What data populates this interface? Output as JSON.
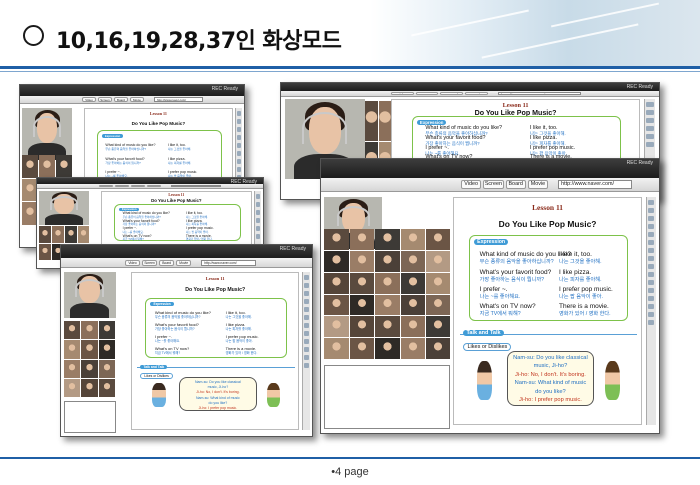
{
  "title": "10,16,19,28,37인 화상모드",
  "footer": "•4 page",
  "window": {
    "app_title": "REC Ready",
    "toolbar": [
      "Video",
      "Screen",
      "Board",
      "Movie"
    ],
    "url": "http://www.naver.com/"
  },
  "lesson": {
    "number": "Lesson 11",
    "question": "Do You Like Pop Music?",
    "expression_tag": "Expression",
    "lines": [
      {
        "en": "What kind of music do you like?",
        "ko": "무슨 종류의 음악을 좋아하십니까?"
      },
      {
        "en": "What's your favorit food?",
        "ko": "가장 좋아하는 음식이 뭡니까?"
      },
      {
        "en": "I prefer ~.",
        "ko": "나는 ~를 좋아해요."
      },
      {
        "en": "What's on TV now?",
        "ko": "지금 TV에서 뭐해?"
      }
    ],
    "answers": [
      {
        "en": "I like it, too.",
        "ko": "나는 그것을 좋아해."
      },
      {
        "en": "I like pizza.",
        "ko": "나는 피자를 좋아해."
      },
      {
        "en": "I prefer pop music.",
        "ko": "나는 팝 음악이 좋아."
      },
      {
        "en": "There is a movie.",
        "ko": "영화가 있어 / 영화 한다."
      }
    ],
    "talk_tag": "Talk and Talk",
    "likes_label": "Likes or Dislikes",
    "dialogue": [
      "Nam-su: Do you like classical",
      "music, Ji-ho?",
      "Ji-ho: No, I don't. It's boring.",
      "Nam-su: What kind of music",
      "do you like?",
      "Ji-ho: I prefer pop music."
    ]
  },
  "colors": {
    "brand_blue": "#1f5fa6",
    "lesson_red": "#8a2a1a",
    "tag_blue": "#3f9bd6",
    "box_green": "#7dc24a"
  }
}
